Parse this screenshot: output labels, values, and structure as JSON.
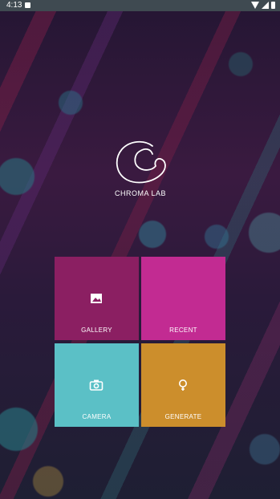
{
  "status_bar": {
    "time": "4:13",
    "icons": [
      "notification-icon",
      "wifi-icon",
      "signal-icon",
      "battery-icon"
    ]
  },
  "app": {
    "name": "CHROMA LAB",
    "logo_icon": "chroma-c-swirl-icon"
  },
  "tiles": [
    {
      "label": "GALLERY",
      "icon": "image-icon",
      "color": "#8b1f62"
    },
    {
      "label": "RECENT",
      "icon": "",
      "color": "#c22b92"
    },
    {
      "label": "CAMERA",
      "icon": "camera-icon",
      "color": "#5bc0c6"
    },
    {
      "label": "GENERATE",
      "icon": "lightbulb-icon",
      "color": "#cc8e2c"
    }
  ]
}
